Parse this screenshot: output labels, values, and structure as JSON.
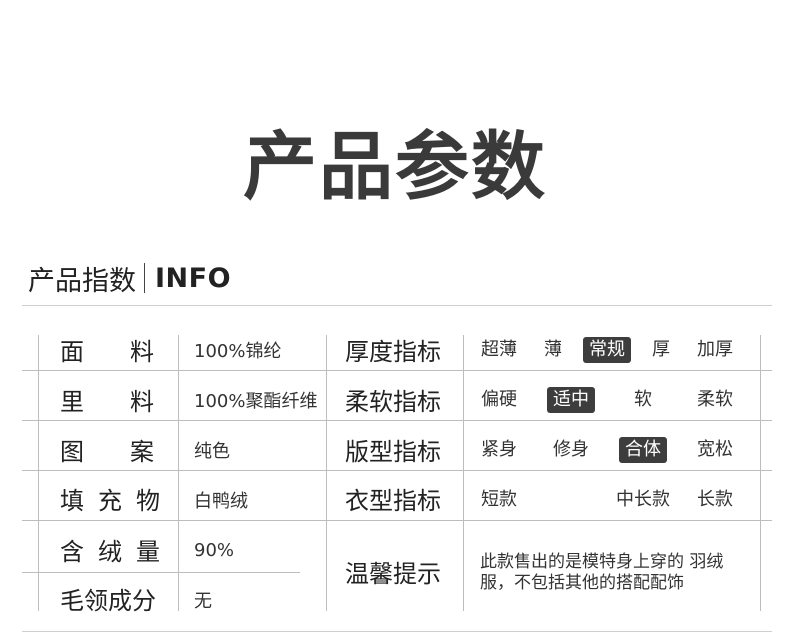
{
  "page": {
    "title": "产品参数",
    "section_cn": "产品指数",
    "section_en": "INFO"
  },
  "left_rows": [
    {
      "label": "面料",
      "value": "100%锦纶"
    },
    {
      "label": "里料",
      "value": "100%聚酯纤维"
    },
    {
      "label": "图案",
      "value": "纯色"
    },
    {
      "label": "填充物",
      "value": "白鸭绒"
    },
    {
      "label": "含绒量",
      "value": "90%"
    },
    {
      "label": "毛领成分",
      "value": "无"
    }
  ],
  "right_rows": [
    {
      "label": "厚度指标",
      "options": [
        "超薄",
        "薄",
        "常规",
        "厚",
        "加厚"
      ],
      "selected": "常规"
    },
    {
      "label": "柔软指标",
      "options": [
        "偏硬",
        "适中",
        "软",
        "柔软"
      ],
      "selected": "适中"
    },
    {
      "label": "版型指标",
      "options": [
        "紧身",
        "修身",
        "合体",
        "宽松"
      ],
      "selected": "合体"
    },
    {
      "label": "衣型指标",
      "options": [
        "短款",
        "中长款",
        "长款"
      ],
      "selected": ""
    }
  ],
  "tip": {
    "label": "温馨提示",
    "text": "此款售出的是模特身上穿的 羽绒服，不包括其他的搭配配饰"
  },
  "colors": {
    "selected_bg": "#3d3d3d",
    "line": "#bdbdbd"
  }
}
